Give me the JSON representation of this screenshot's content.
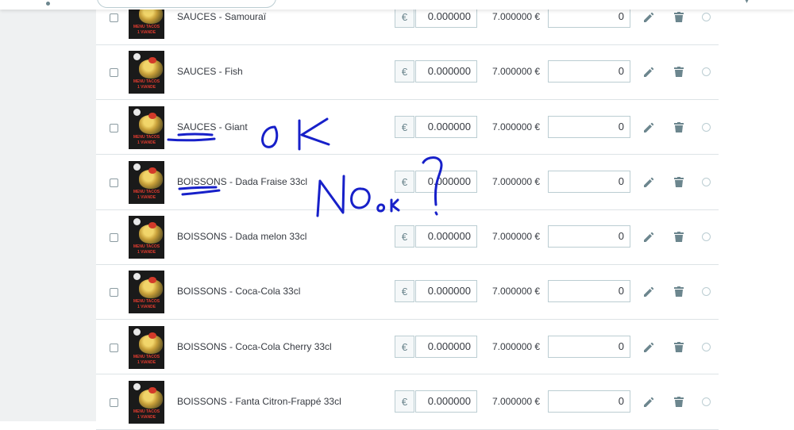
{
  "currency_symbol": "€",
  "ink_color": "#1720c9",
  "rows": [
    {
      "name": "SAUCES - Samouraï",
      "price": "0.000000",
      "final_price": "7.000000 €",
      "quantity": "0"
    },
    {
      "name": "SAUCES - Fish",
      "price": "0.000000",
      "final_price": "7.000000 €",
      "quantity": "0"
    },
    {
      "name": "SAUCES - Giant",
      "price": "0.000000",
      "final_price": "7.000000 €",
      "quantity": "0"
    },
    {
      "name": "BOISSONS - Dada Fraise 33cl",
      "price": "0.000000",
      "final_price": "7.000000 €",
      "quantity": "0"
    },
    {
      "name": "BOISSONS - Dada melon 33cl",
      "price": "0.000000",
      "final_price": "7.000000 €",
      "quantity": "0"
    },
    {
      "name": "BOISSONS - Coca-Cola 33cl",
      "price": "0.000000",
      "final_price": "7.000000 €",
      "quantity": "0"
    },
    {
      "name": "BOISSONS - Coca-Cola Cherry 33cl",
      "price": "0.000000",
      "final_price": "7.000000 €",
      "quantity": "0"
    },
    {
      "name": "BOISSONS - Fanta Citron-Frappé 33cl",
      "price": "0.000000",
      "final_price": "7.000000 €",
      "quantity": "0"
    }
  ],
  "thumbnail": {
    "line1": "MENU TACOS",
    "line2": "1 VIANDE"
  },
  "annotations": {
    "ok": "OK",
    "no": "NO",
    "ok_small": "OK",
    "question": "?"
  }
}
